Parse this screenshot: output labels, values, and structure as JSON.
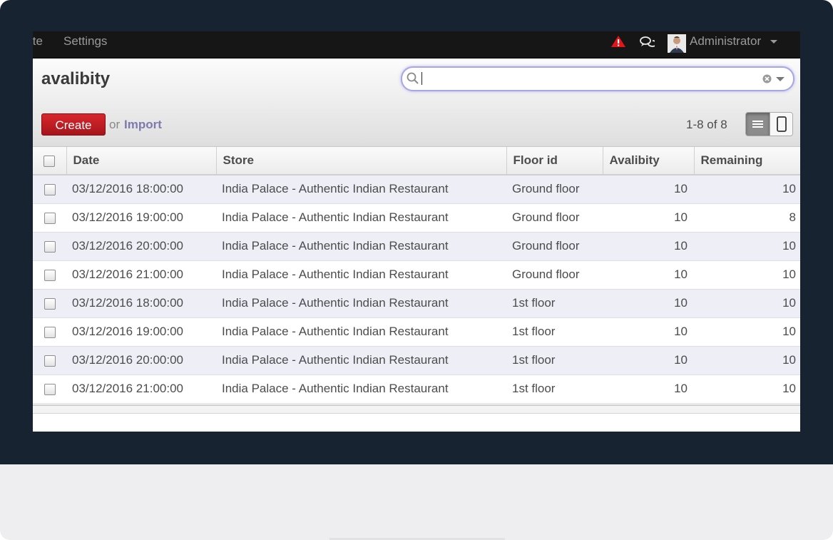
{
  "topbar": {
    "menu": [
      "ite",
      "Settings"
    ],
    "user_name": "Administrator",
    "icons": [
      "alert-icon",
      "chat-icon",
      "avatar"
    ],
    "alert_color": "#e3151b"
  },
  "control_panel": {
    "title": "avalibity",
    "search": {
      "value": "",
      "placeholder": ""
    },
    "create_label": "Create",
    "or_label": "or",
    "import_label": "Import",
    "pager": "1-8 of 8",
    "views": [
      "list",
      "form"
    ],
    "active_view": "list"
  },
  "table": {
    "columns": [
      "Date",
      "Store",
      "Floor id",
      "Avalibity",
      "Remaining"
    ],
    "rows": [
      {
        "date": "03/12/2016 18:00:00",
        "store": "India Palace - Authentic Indian Restaurant",
        "floor": "Ground floor",
        "availability": "10",
        "remaining": "10"
      },
      {
        "date": "03/12/2016 19:00:00",
        "store": "India Palace - Authentic Indian Restaurant",
        "floor": "Ground floor",
        "availability": "10",
        "remaining": "8"
      },
      {
        "date": "03/12/2016 20:00:00",
        "store": "India Palace - Authentic Indian Restaurant",
        "floor": "Ground floor",
        "availability": "10",
        "remaining": "10"
      },
      {
        "date": "03/12/2016 21:00:00",
        "store": "India Palace - Authentic Indian Restaurant",
        "floor": "Ground floor",
        "availability": "10",
        "remaining": "10"
      },
      {
        "date": "03/12/2016 18:00:00",
        "store": "India Palace - Authentic Indian Restaurant",
        "floor": "1st floor",
        "availability": "10",
        "remaining": "10"
      },
      {
        "date": "03/12/2016 19:00:00",
        "store": "India Palace - Authentic Indian Restaurant",
        "floor": "1st floor",
        "availability": "10",
        "remaining": "10"
      },
      {
        "date": "03/12/2016 20:00:00",
        "store": "India Palace - Authentic Indian Restaurant",
        "floor": "1st floor",
        "availability": "10",
        "remaining": "10"
      },
      {
        "date": "03/12/2016 21:00:00",
        "store": "India Palace - Authentic Indian Restaurant",
        "floor": "1st floor",
        "availability": "10",
        "remaining": "10"
      }
    ]
  },
  "colors": {
    "bezel": "#172330",
    "create_button": "#c41e25",
    "import_link": "#7c7bad",
    "row_stripe": "#eeeef7"
  }
}
